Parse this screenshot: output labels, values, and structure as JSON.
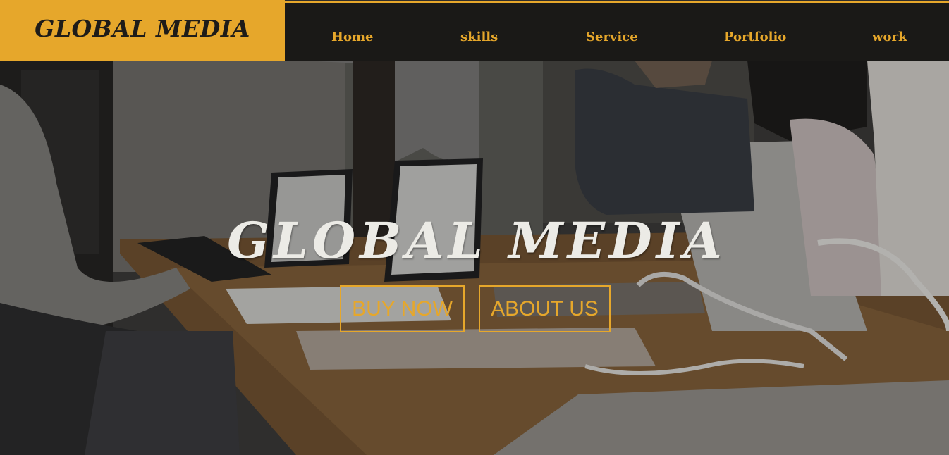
{
  "brand": {
    "logo_text": "GLOBAL MEDIA"
  },
  "nav": {
    "items": [
      {
        "label": "Home"
      },
      {
        "label": "skills"
      },
      {
        "label": "Service"
      },
      {
        "label": "Portfolio"
      },
      {
        "label": "work"
      }
    ]
  },
  "hero": {
    "title": "GLOBAL MEDIA",
    "buttons": {
      "buy_now": "BUY NOW",
      "about_us": "ABOUT US"
    }
  },
  "colors": {
    "accent": "#e6a72b",
    "nav_background": "#1a1917",
    "hero_title": "#ecebe6"
  }
}
